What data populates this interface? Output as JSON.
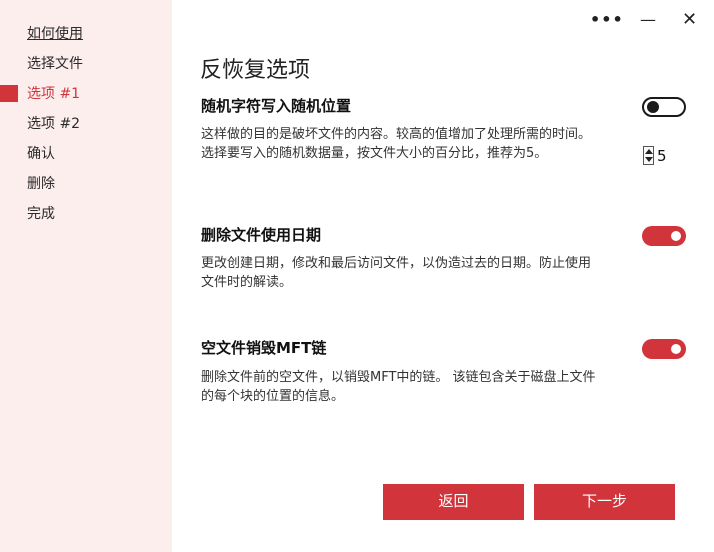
{
  "window": {
    "more_label": "•••",
    "minimize_label": "—",
    "close_label": "✕"
  },
  "sidebar": {
    "items": [
      {
        "label": "如何使用"
      },
      {
        "label": "选择文件"
      },
      {
        "label": "选项 #1"
      },
      {
        "label": "选项 #2"
      },
      {
        "label": "确认"
      },
      {
        "label": "删除"
      },
      {
        "label": "完成"
      }
    ],
    "active_index": 2
  },
  "main": {
    "title": "反恢复选项",
    "options": [
      {
        "title": "随机字符写入随机位置",
        "description": "这样做的目的是破坏文件的内容。较高的值增加了处理所需的时间。 选择要写入的随机数据量，按文件大小的百分比，推荐为5。",
        "enabled": false,
        "value": "5"
      },
      {
        "title": "删除文件使用日期",
        "description": "更改创建日期，修改和最后访问文件，以伪造过去的日期。防止使用文件时的解读。",
        "enabled": true
      },
      {
        "title": "空文件销毁MFT链",
        "description": "删除文件前的空文件，以销毁MFT中的链。 该链包含关于磁盘上文件的每个块的位置的信息。",
        "enabled": true
      }
    ]
  },
  "footer": {
    "back_label": "返回",
    "next_label": "下一步"
  },
  "colors": {
    "accent": "#d1343b",
    "sidebar_bg": "#fdeeee"
  }
}
